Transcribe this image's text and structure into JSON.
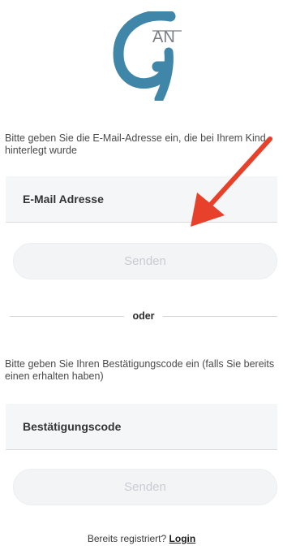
{
  "logo": {
    "letters_main": "G",
    "letters_small": "AN",
    "color": "#3f86a8"
  },
  "email_section": {
    "instruction": "Bitte geben Sie die E-Mail-Adresse ein, die bei Ihrem Kind hinterlegt wurde",
    "input_placeholder": "E-Mail Adresse",
    "input_value": "",
    "send_label": "Senden"
  },
  "divider": {
    "label": "oder"
  },
  "code_section": {
    "instruction": "Bitte geben Sie Ihren Bestätigungscode ein (falls Sie bereits einen erhalten haben)",
    "input_placeholder": "Bestätigungscode",
    "input_value": "",
    "send_label": "Senden"
  },
  "footer": {
    "prompt": "Bereits registriert?",
    "login_label": "Login"
  },
  "annotation": {
    "arrow_color": "#e8412b",
    "arrow_icon": "red-arrow-icon"
  },
  "colors": {
    "field_bg": "#f5f6f8",
    "button_bg": "#f3f4f6",
    "button_text_disabled": "#c8ccd2"
  }
}
